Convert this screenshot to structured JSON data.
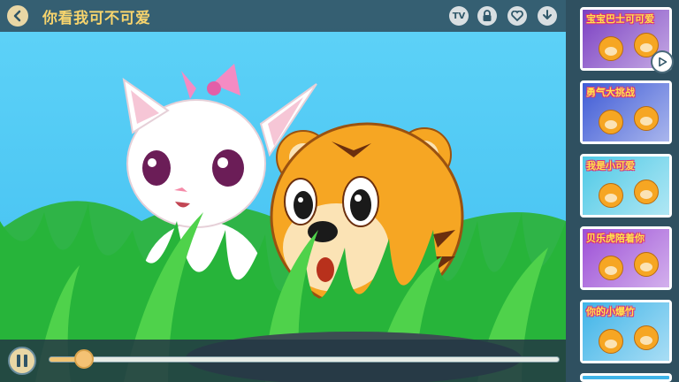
{
  "header": {
    "title": "你看我可不可爱",
    "icons": [
      "back-icon",
      "tv-icon",
      "lock-icon",
      "heart-icon",
      "download-icon"
    ],
    "tv_label": "TV"
  },
  "player": {
    "state": "playing",
    "progress": 0.07
  },
  "sidebar": {
    "items": [
      {
        "title": "宝宝巴士可可爱",
        "bg": "#7b3fc2",
        "active": true
      },
      {
        "title": "勇气大挑战",
        "bg": "#3f5bd6"
      },
      {
        "title": "我是小可爱",
        "bg": "#4ec9e6"
      },
      {
        "title": "贝乐虎陪着你",
        "bg": "#9c4ed6"
      },
      {
        "title": "你的小爆竹",
        "bg": "#3fb4e8"
      }
    ]
  },
  "colors": {
    "accent": "#f7d46d",
    "bar": "#2c4654",
    "sky": "#5fd3f8",
    "grass": "#27b43a"
  }
}
